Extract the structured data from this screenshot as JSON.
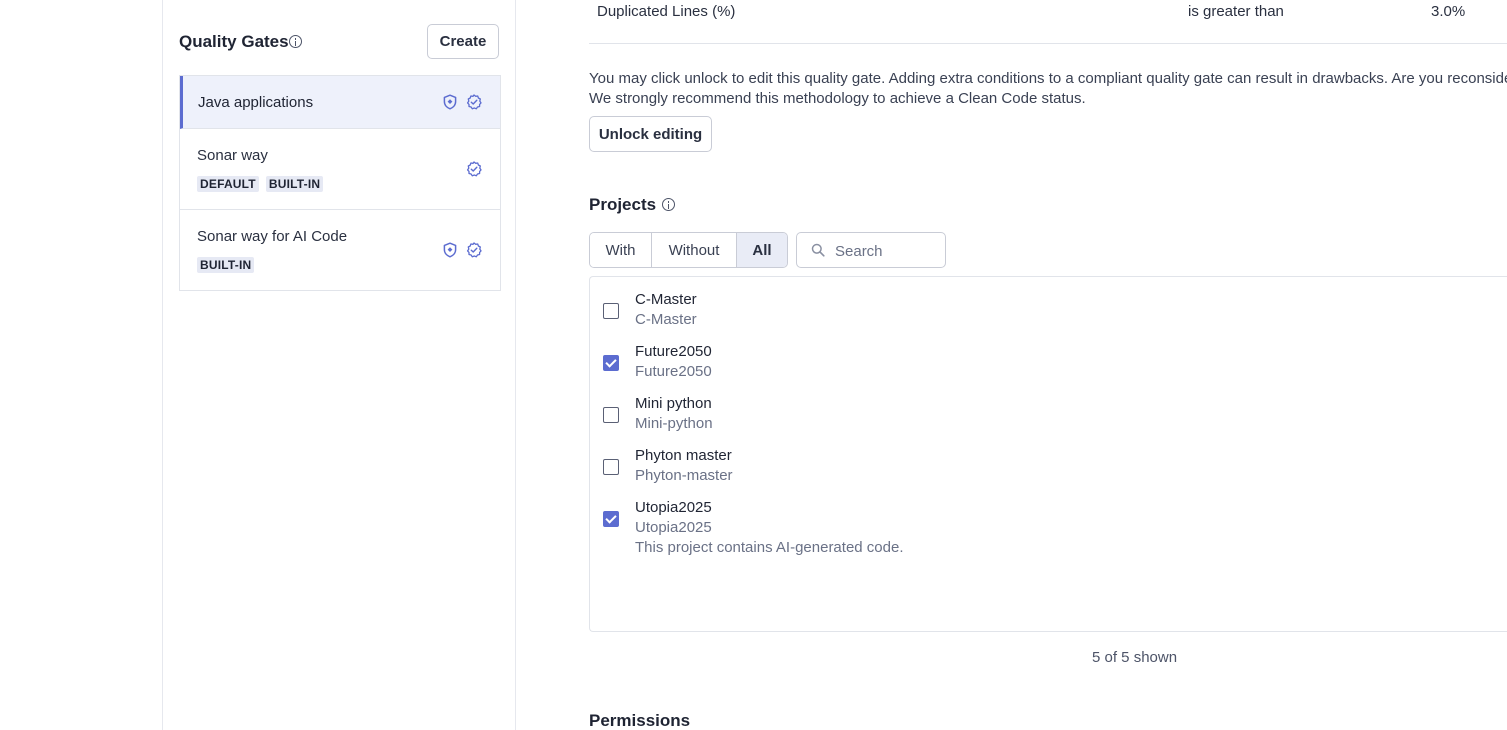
{
  "sidebar": {
    "title": "Quality Gates",
    "create_label": "Create",
    "gates": [
      {
        "name": "Java applications",
        "badges": [],
        "selected": true,
        "icons": [
          "shield-icon",
          "verified-badge-icon"
        ]
      },
      {
        "name": "Sonar way",
        "badges": [
          "DEFAULT",
          "BUILT-IN"
        ],
        "selected": false,
        "icons": [
          "verified-badge-icon"
        ]
      },
      {
        "name": "Sonar way for AI Code",
        "badges": [
          "BUILT-IN"
        ],
        "selected": false,
        "icons": [
          "shield-icon",
          "verified-badge-icon"
        ]
      }
    ]
  },
  "condition": {
    "metric": "Duplicated Lines (%)",
    "operator": "is greater than",
    "value": "3.0%"
  },
  "notice": {
    "line1": "You may click unlock to edit this quality gate. Adding extra conditions to a compliant quality gate can result in drawbacks. Are you reconsidering",
    "line2": "We strongly recommend this methodology to achieve a Clean Code status."
  },
  "unlock_label": "Unlock editing",
  "projects": {
    "title": "Projects",
    "filters": {
      "with": "With",
      "without": "Without",
      "all": "All",
      "active": "all"
    },
    "search_placeholder": "Search",
    "items": [
      {
        "name": "C-Master",
        "key": "C-Master",
        "checked": false,
        "note": ""
      },
      {
        "name": "Future2050",
        "key": "Future2050",
        "checked": true,
        "note": ""
      },
      {
        "name": "Mini python",
        "key": "Mini-python",
        "checked": false,
        "note": ""
      },
      {
        "name": "Phyton master",
        "key": "Phyton-master",
        "checked": false,
        "note": ""
      },
      {
        "name": "Utopia2025",
        "key": "Utopia2025",
        "checked": true,
        "note": "This project contains AI-generated code."
      }
    ],
    "shown_text": "5 of 5 shown"
  },
  "permissions_title": "Permissions",
  "colors": {
    "accent": "#5c6cd0",
    "selected_bg": "#eef1fb",
    "border": "#e1e4ea"
  }
}
